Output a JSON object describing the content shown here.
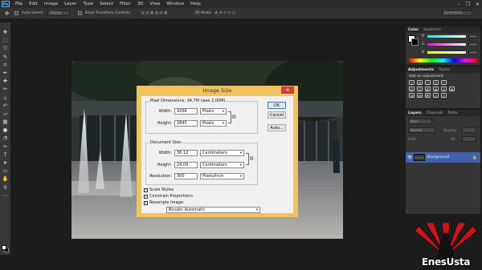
{
  "app": {
    "logo": "Ps",
    "accent": "#5eb3f2"
  },
  "menu": [
    "File",
    "Edit",
    "Image",
    "Layer",
    "Type",
    "Select",
    "Filter",
    "3D",
    "View",
    "Window",
    "Help"
  ],
  "window_controls": {
    "minimize": "–",
    "restore": "❐",
    "close": "✕"
  },
  "options_bar": {
    "auto_select": "Auto-Select:",
    "auto_select_value": "Group",
    "show_transform": "Show Transform Controls",
    "mode_3d": "3D Mode:",
    "workspace": "Essentials"
  },
  "color_panel": {
    "tabs": [
      "Color",
      "Swatches"
    ],
    "labels": [
      "R",
      "G",
      "B"
    ]
  },
  "adjustments_panel": {
    "tabs": [
      "Adjustments",
      "Styles"
    ],
    "title": "Add an adjustment"
  },
  "layers_panel": {
    "tabs": [
      "Layers",
      "Channels",
      "Paths"
    ],
    "kind": "Kind",
    "blend_mode": "Normal",
    "opacity": "Opacity:",
    "lock": "Lock:",
    "fill": "Fill:",
    "layer_name": "Background"
  },
  "dialog": {
    "title": "Image Size",
    "pixel_dimensions": "Pixel Dimensions:  34,7M (was 2,00M)",
    "width_label": "Width:",
    "height_label": "Height:",
    "pixel_width": "4266",
    "pixel_height": "2845",
    "pixel_unit_w": "Pixels",
    "pixel_unit_h": "Pixels",
    "document_size": "Document Size:",
    "doc_width": "36,12",
    "doc_height": "24,09",
    "doc_unit_w": "Centimeters",
    "doc_unit_h": "Centimeters",
    "resolution_label": "Resolution:",
    "resolution": "300",
    "resolution_unit": "Pixels/Inch",
    "ok": "OK",
    "cancel": "Cancel",
    "auto": "Auto...",
    "scale_styles": "Scale Styles",
    "constrain": "Constrain Proportions",
    "resample": "Resample Image:",
    "resample_method": "Bicubic Automatic"
  },
  "watermark": "EnesUsta"
}
